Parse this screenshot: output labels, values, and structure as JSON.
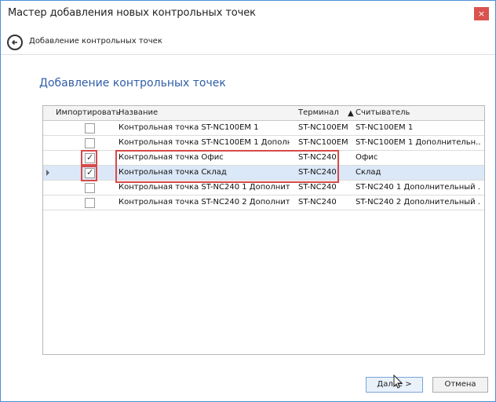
{
  "window": {
    "title": "Мастер добавления новых контрольных точек",
    "close_glyph": "×"
  },
  "nav": {
    "back_icon": "back-arrow-circle",
    "label": "Добавление контрольных точек"
  },
  "main": {
    "heading": "Добавление контрольных точек",
    "table": {
      "columns": [
        "Импортировать",
        "Название",
        "Терминал",
        "Считыватель"
      ],
      "rows": [
        {
          "name": "Контрольная точка ST-NC100EM 1",
          "terminal": "ST-NC100EM",
          "reader": "ST-NC100EM 1",
          "checked": false
        },
        {
          "name": "Контрольная точка ST-NC100EM 1 Дополн...",
          "terminal": "ST-NC100EM",
          "reader": "ST-NC100EM 1 Дополнительн...",
          "checked": false
        },
        {
          "name": "Контрольная точка Офис",
          "terminal": "ST-NC240",
          "reader": "Офис",
          "checked": true
        },
        {
          "name": "Контрольная точка Склад",
          "terminal": "ST-NC240",
          "reader": "Склад",
          "checked": true
        },
        {
          "name": "Контрольная точка ST-NC240 1 Дополните...",
          "terminal": "ST-NC240",
          "reader": "ST-NC240 1 Дополнительный ...",
          "checked": false
        },
        {
          "name": "Контрольная точка ST-NC240 2 Дополните...",
          "terminal": "ST-NC240",
          "reader": "ST-NC240 2 Дополнительный ...",
          "checked": false
        }
      ]
    }
  },
  "buttons": {
    "next": "Далее >",
    "cancel": "Отмена"
  },
  "colors": {
    "heading": "#2f5da8",
    "highlight": "#d64a4a",
    "selected_row": "#dbe8f7"
  }
}
